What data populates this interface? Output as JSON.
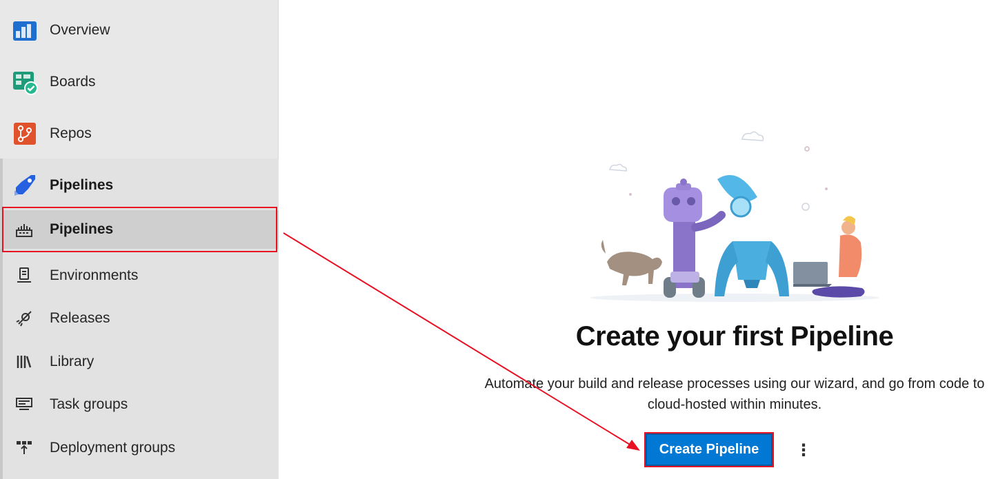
{
  "sidebar": {
    "top_items": [
      {
        "label": "Overview",
        "icon": "overview-icon"
      },
      {
        "label": "Boards",
        "icon": "boards-icon"
      },
      {
        "label": "Repos",
        "icon": "repos-icon"
      },
      {
        "label": "Pipelines",
        "icon": "pipelines-icon"
      }
    ],
    "sub_items": [
      {
        "label": "Pipelines",
        "icon": "pipelines-sub-icon",
        "selected": true
      },
      {
        "label": "Environments",
        "icon": "environments-icon"
      },
      {
        "label": "Releases",
        "icon": "releases-icon"
      },
      {
        "label": "Library",
        "icon": "library-icon"
      },
      {
        "label": "Task groups",
        "icon": "task-groups-icon"
      },
      {
        "label": "Deployment groups",
        "icon": "deployment-groups-icon"
      }
    ]
  },
  "main": {
    "title": "Create your first Pipeline",
    "description": "Automate your build and release processes using our wizard, and go from code to cloud-hosted within minutes.",
    "create_button_label": "Create Pipeline",
    "more_icon": "more-options-icon"
  },
  "colors": {
    "accent": "#0078d4",
    "annotation": "#e81123",
    "sidebar_bg": "#e8e8e8"
  }
}
